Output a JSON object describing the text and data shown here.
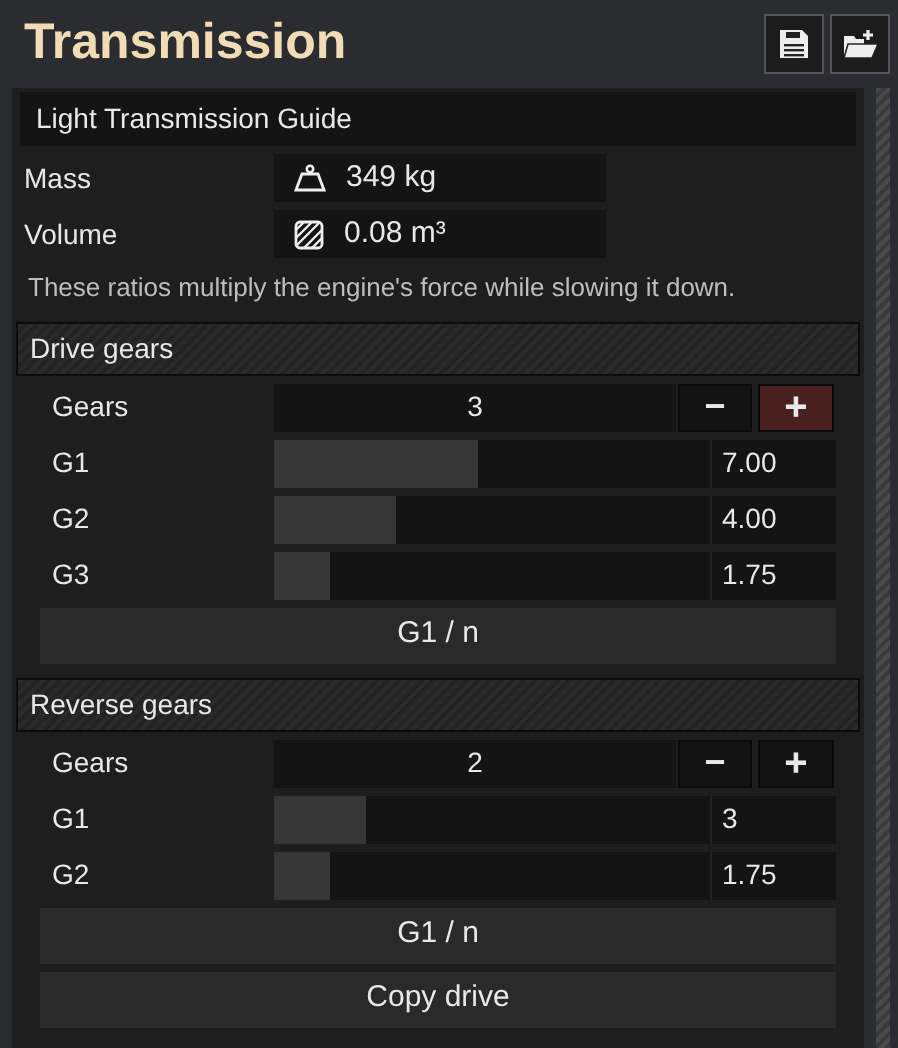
{
  "window": {
    "title": "Transmission"
  },
  "toolbar": [
    {
      "kind": "save"
    },
    {
      "kind": "open"
    }
  ],
  "preset": "Light Transmission Guide",
  "stats": [
    {
      "label": "Mass",
      "kind": "mass",
      "value": "349 kg"
    },
    {
      "label": "Volume",
      "kind": "volume",
      "value": "0.08 m³"
    }
  ],
  "description": "These ratios multiply the engine's force while slowing it down.",
  "sections": [
    {
      "title": "Drive gears",
      "count_label": "Gears",
      "count": "3",
      "minus": "−",
      "plus": {
        "text": "+",
        "highlighted": true
      },
      "gears": [
        {
          "label": "G1",
          "level": 0.47,
          "value": "7.00"
        },
        {
          "label": "G2",
          "level": 0.28,
          "value": "4.00"
        },
        {
          "label": "G3",
          "level": 0.13,
          "value": "1.75"
        }
      ],
      "button": "G1 / n"
    },
    {
      "title": "Reverse gears",
      "count_label": "Gears",
      "count": "2",
      "minus": "−",
      "plus": {
        "text": "+",
        "highlighted": false
      },
      "gears": [
        {
          "label": "G1",
          "level": 0.21,
          "value": "3"
        },
        {
          "label": "G2",
          "level": 0.13,
          "value": "1.75"
        }
      ],
      "button": "G1 / n"
    }
  ],
  "footer_button": "Copy drive"
}
